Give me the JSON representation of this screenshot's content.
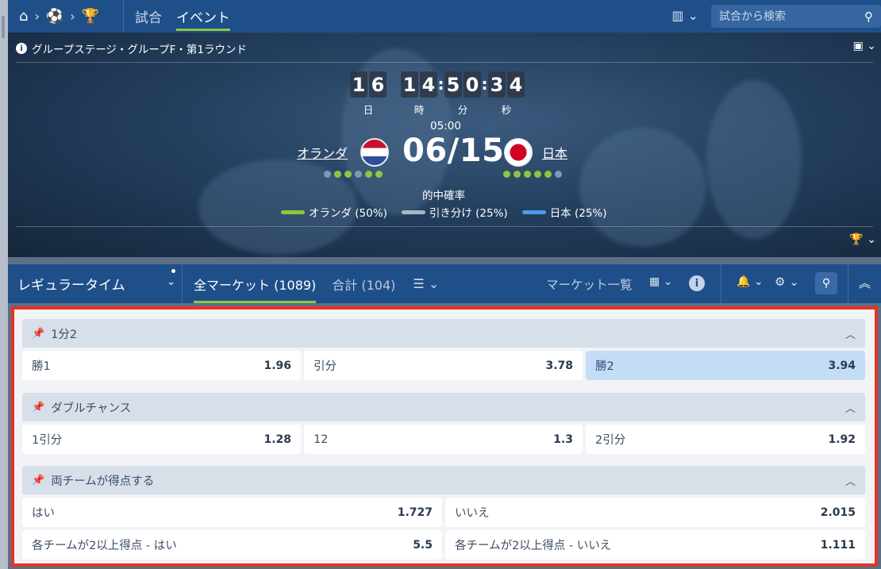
{
  "nav": {
    "home_icon": "home-icon",
    "sport_icon": "soccer-ball-icon",
    "trophy_icon": "trophy-icon",
    "tabs": [
      {
        "label": "試合",
        "active": false
      },
      {
        "label": "イベント",
        "active": true
      }
    ],
    "search_placeholder": "試合から検索"
  },
  "hero": {
    "stage": "グループステージ・グループF・第1ラウンド",
    "countdown": {
      "days": [
        "1",
        "6"
      ],
      "hours": [
        "1",
        "4"
      ],
      "minutes": [
        "5",
        "0"
      ],
      "seconds": [
        "3",
        "4"
      ],
      "labels": {
        "days": "日",
        "hours": "時",
        "minutes": "分",
        "seconds": "秒"
      }
    },
    "kickoff_time": "05:00",
    "date": "06/15",
    "home_team": "オランダ",
    "away_team": "日本",
    "probability_title": "的中確率",
    "probabilities": [
      {
        "label": "オランダ (50%)",
        "color": "#8ec63f"
      },
      {
        "label": "引き分け (25%)",
        "color": "#a9b6c6"
      },
      {
        "label": "日本 (25%)",
        "color": "#4f9be8"
      }
    ]
  },
  "toolbar": {
    "period": "レギュラータイム",
    "all_markets": "全マーケット (1089)",
    "total": "合計 (104)",
    "market_list": "マーケット一覧"
  },
  "markets": [
    {
      "title": "1分2",
      "outcomes": [
        {
          "label": "勝1",
          "price": "1.96"
        },
        {
          "label": "引分",
          "price": "3.78"
        },
        {
          "label": "勝2",
          "price": "3.94",
          "selected": true
        }
      ]
    },
    {
      "title": "ダブルチャンス",
      "outcomes": [
        {
          "label": "1引分",
          "price": "1.28"
        },
        {
          "label": "12",
          "price": "1.3"
        },
        {
          "label": "2引分",
          "price": "1.92"
        }
      ]
    },
    {
      "title": "両チームが得点する",
      "outcomes": [
        {
          "label": "はい",
          "price": "1.727"
        },
        {
          "label": "いいえ",
          "price": "2.015"
        },
        {
          "label": "各チームが2以上得点 - はい",
          "price": "5.5"
        },
        {
          "label": "各チームが2以上得点 - いいえ",
          "price": "1.111"
        }
      ]
    }
  ],
  "colors": {
    "nav_bg": "#1f4f89",
    "accent_green": "#8ec63f",
    "highlight_border": "#e53323",
    "selected_odd": "#c5dcf5"
  }
}
